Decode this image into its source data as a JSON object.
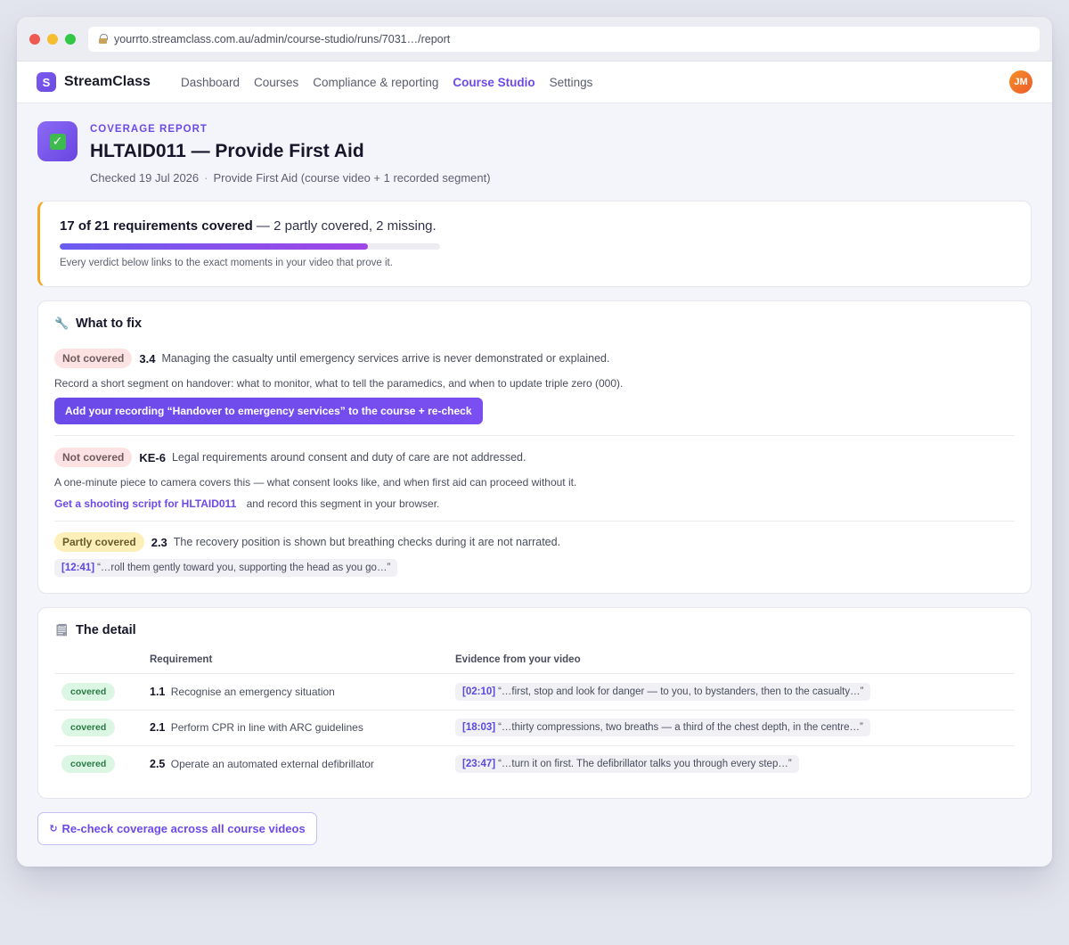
{
  "browser": {
    "url": "yourrto.streamclass.com.au/admin/course-studio/runs/7031…/report"
  },
  "nav": {
    "logo_letter": "S",
    "brand": "StreamClass",
    "links": [
      "Dashboard",
      "Courses",
      "Compliance & reporting",
      "Course Studio",
      "Settings"
    ],
    "active_index": 3,
    "avatar_initials": "JM"
  },
  "header": {
    "eyebrow": "COVERAGE REPORT",
    "title": "HLTAID011 — Provide First Aid",
    "checked": "Checked 19 Jul 2026",
    "separator": "·",
    "source": "Provide First Aid (course video + 1 recorded segment)"
  },
  "summary": {
    "headline": "17 of 21 requirements covered",
    "detail": " — 2 partly covered, 2 missing.",
    "progress_fraction": 0.81,
    "note": "Every verdict below links to the exact moments in your video that prove it."
  },
  "fix": {
    "title": "What to fix",
    "items": [
      {
        "status": "Not covered",
        "id": "3.4",
        "text": "Managing the casualty until emergency services arrive is never demonstrated or explained.",
        "advice": "Record a short segment on handover: what to monitor, what to tell the paramedics, and when to update triple zero (000).",
        "button": "Add your recording “Handover to emergency services” to the course + re-check"
      },
      {
        "status": "Not covered",
        "id": "KE-6",
        "text": "Legal requirements around consent and duty of care are not addressed.",
        "advice": "A one-minute piece to camera covers this — what consent looks like, and when first aid can proceed without it.",
        "link": "Get a shooting script for HLTAID011",
        "link_suffix": "and record this segment in your browser."
      },
      {
        "status": "Partly covered",
        "id": "2.3",
        "text": "The recovery position is shown but breathing checks during it are not narrated.",
        "timestamp": "[12:41]",
        "quote": "“…roll them gently toward you, supporting the head as you go…”"
      }
    ]
  },
  "detail": {
    "title": "The detail",
    "col_requirement": "Requirement",
    "col_evidence": "Evidence from your video",
    "rows": [
      {
        "status": "covered",
        "id": "1.1",
        "name": "Recognise an emergency situation",
        "timestamp": "[02:10]",
        "quote": "“…first, stop and look for danger — to you, to bystanders, then to the casualty…”"
      },
      {
        "status": "covered",
        "id": "2.1",
        "name": "Perform CPR in line with ARC guidelines",
        "timestamp": "[18:03]",
        "quote": "“…thirty compressions, two breaths — a third of the chest depth, in the centre…”"
      },
      {
        "status": "covered",
        "id": "2.5",
        "name": "Operate an automated external defibrillator",
        "timestamp": "[23:47]",
        "quote": "“…turn it on first. The defibrillator talks you through every step…”"
      }
    ]
  },
  "recheck": {
    "symbol": "↻",
    "label": "Re-check coverage across all course videos"
  },
  "colors": {
    "accent": "#6d4ae8",
    "summary_border": "#f5a623",
    "covered": "#2a7a45",
    "missing_bg": "#fde2e2",
    "partial_bg": "#fcefb8"
  },
  "icons": {
    "header": "check-box-icon",
    "fix_section": "wrench-icon",
    "detail_section": "notepad-icon",
    "url_lock": "lock-icon"
  }
}
